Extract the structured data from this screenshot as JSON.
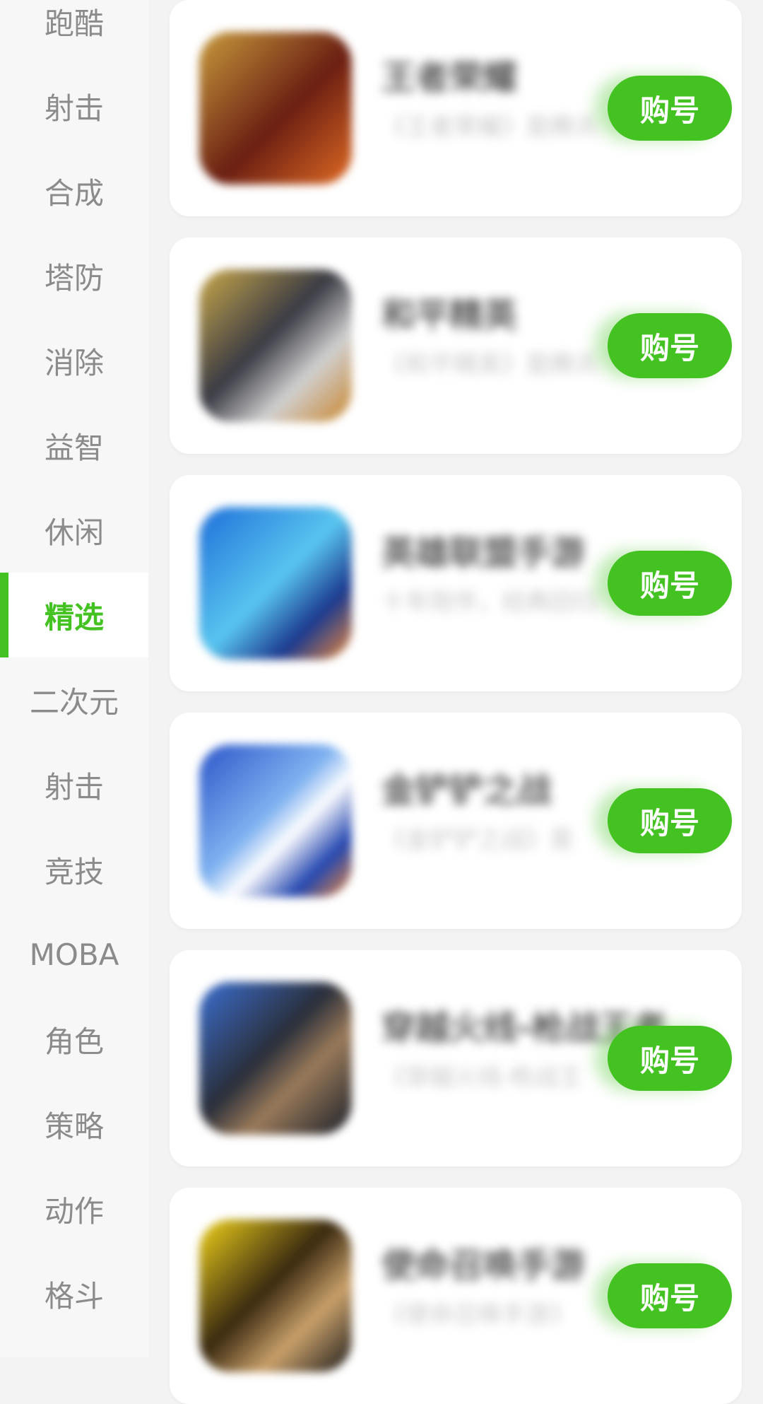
{
  "sidebar": {
    "items": [
      {
        "label": "跑酷"
      },
      {
        "label": "射击"
      },
      {
        "label": "合成"
      },
      {
        "label": "塔防"
      },
      {
        "label": "消除"
      },
      {
        "label": "益智"
      },
      {
        "label": "休闲"
      },
      {
        "label": "精选",
        "active": true
      },
      {
        "label": "二次元"
      },
      {
        "label": "射击"
      },
      {
        "label": "竞技"
      },
      {
        "label": "MOBA"
      },
      {
        "label": "角色"
      },
      {
        "label": "策略"
      },
      {
        "label": "动作"
      },
      {
        "label": "格斗"
      }
    ]
  },
  "games": [
    {
      "title": "王者荣耀",
      "desc": "《王者荣耀》是腾讯",
      "button": "购号"
    },
    {
      "title": "和平精英",
      "desc": "《和平精英》是腾讯",
      "button": "购号"
    },
    {
      "title": "英雄联盟手游",
      "desc": "十年陪伴，经典回归",
      "button": "购号"
    },
    {
      "title": "金铲铲之战",
      "desc": "《金铲铲之战》是",
      "button": "购号"
    },
    {
      "title": "穿越火线-枪战王者",
      "desc": "《穿越火线-枪战王",
      "button": "购号"
    },
    {
      "title": "使命召唤手游",
      "desc": "《使命召唤手游》",
      "button": "购号"
    }
  ],
  "colors": {
    "accent": "#43c222"
  }
}
